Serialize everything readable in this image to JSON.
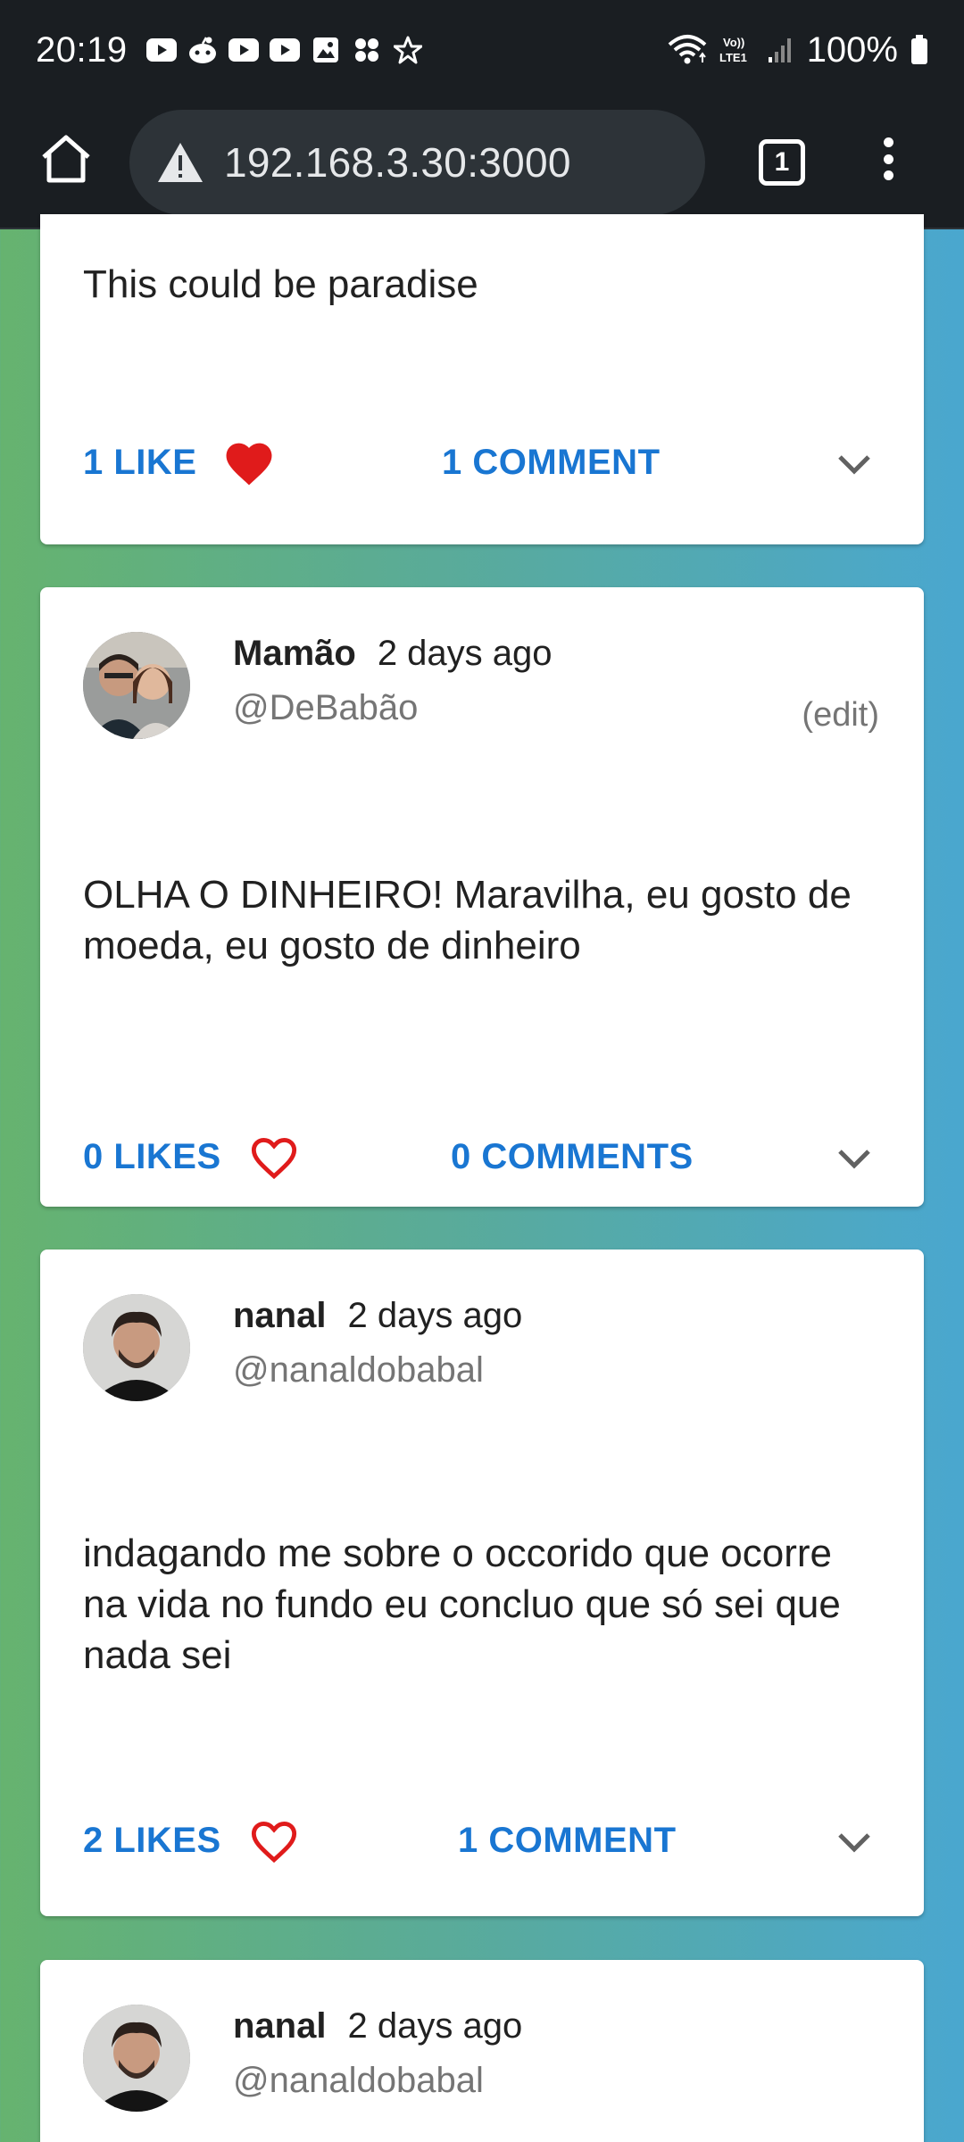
{
  "status_bar": {
    "time": "20:19",
    "notification_icons": [
      "youtube-icon",
      "reddit-icon",
      "youtube-icon",
      "youtube-icon",
      "gallery-icon",
      "apps-icon",
      "star-icon"
    ],
    "battery": "100%"
  },
  "browser": {
    "url": "192.168.3.30:3000",
    "tab_count": "1"
  },
  "posts": [
    {
      "text": "This could be paradise",
      "likes_label": "1 LIKE",
      "liked": true,
      "comments_label": "1 COMMENT"
    },
    {
      "author_name": "Mamão",
      "time": "2 days ago",
      "handle": "@DeBabão",
      "edit_label": "(edit)",
      "text": "OLHA O DINHEIRO! Maravilha, eu gosto de moeda, eu gosto de dinheiro",
      "likes_label": "0 LIKES",
      "liked": false,
      "comments_label": "0 COMMENTS"
    },
    {
      "author_name": "nanal",
      "time": "2 days ago",
      "handle": "@nanaldobabal",
      "text": "indagando me sobre o occorido que ocorre na vida no fundo eu concluo que só sei que nada sei",
      "likes_label": "2 LIKES",
      "liked": false,
      "comments_label": "1 COMMENT"
    },
    {
      "author_name": "nanal",
      "time": "2 days ago",
      "handle": "@nanaldobabal"
    }
  ],
  "colors": {
    "accent": "#1976d2",
    "heart": "#e01b1b",
    "bar": "#1a1e22"
  }
}
